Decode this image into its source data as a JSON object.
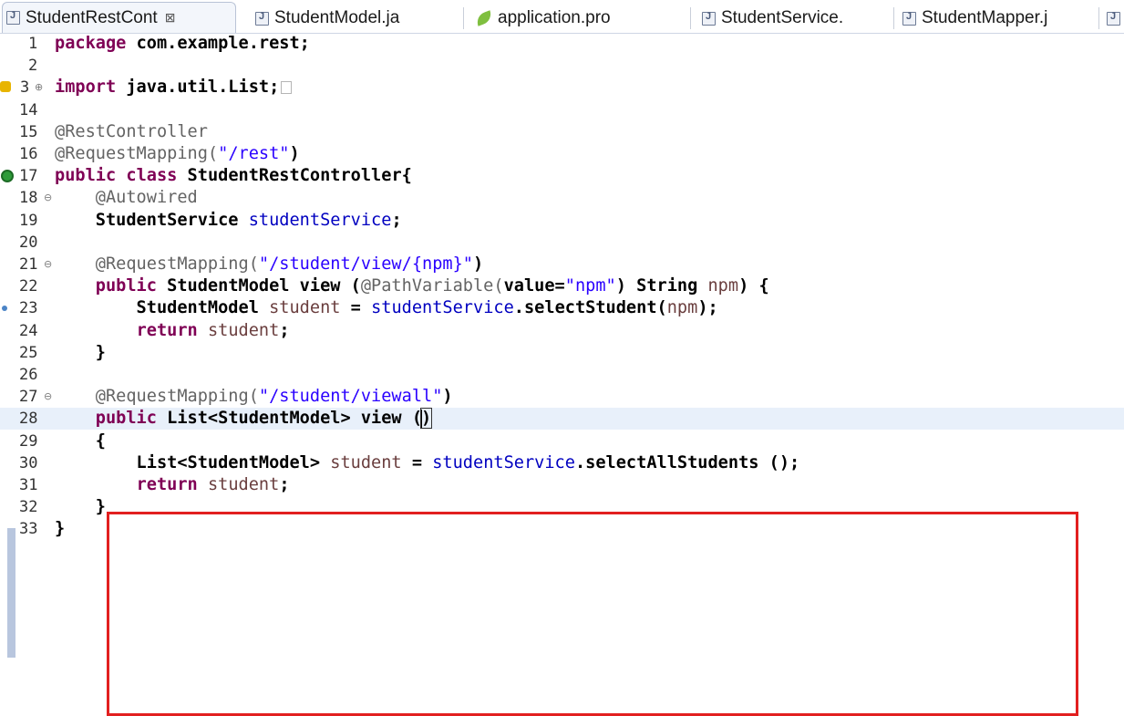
{
  "tabs": [
    {
      "label": "StudentRestCont",
      "icon": "java-file-icon",
      "active": true,
      "close": "⊠"
    },
    {
      "label": "StudentModel.ja",
      "icon": "java-file-icon",
      "active": false
    },
    {
      "label": "application.pro",
      "icon": "properties-leaf-icon",
      "active": false
    },
    {
      "label": "StudentService.",
      "icon": "java-file-icon",
      "active": false
    },
    {
      "label": "StudentMapper.j",
      "icon": "java-file-icon",
      "active": false
    }
  ],
  "editor": {
    "line_numbers": [
      "1",
      "2",
      "3",
      "14",
      "15",
      "16",
      "17",
      "18",
      "19",
      "20",
      "21",
      "22",
      "23",
      "24",
      "25",
      "26",
      "27",
      "28",
      "29",
      "30",
      "31",
      "32",
      "33"
    ],
    "lines": [
      [
        {
          "t": "package",
          "c": "kw"
        },
        {
          "t": " com.example.rest;",
          "c": "bold"
        }
      ],
      [],
      [
        {
          "t": "import",
          "c": "kw"
        },
        {
          "t": " java.util.List;",
          "c": "bold"
        }
      ],
      [],
      [
        {
          "t": "@RestController",
          "c": "ann"
        }
      ],
      [
        {
          "t": "@RequestMapping(",
          "c": "ann"
        },
        {
          "t": "\"/rest\"",
          "c": "str"
        },
        {
          "t": ")",
          "c": "bold"
        }
      ],
      [
        {
          "t": "public",
          "c": "kw"
        },
        {
          "t": " ",
          "c": ""
        },
        {
          "t": "class",
          "c": "kw"
        },
        {
          "t": " StudentRestController{",
          "c": "bold"
        }
      ],
      [
        {
          "t": "    ",
          "c": ""
        },
        {
          "t": "@Autowired",
          "c": "ann"
        }
      ],
      [
        {
          "t": "    StudentService ",
          "c": "bold"
        },
        {
          "t": "studentService",
          "c": "fld"
        },
        {
          "t": ";",
          "c": "bold"
        }
      ],
      [],
      [
        {
          "t": "    ",
          "c": ""
        },
        {
          "t": "@RequestMapping(",
          "c": "ann"
        },
        {
          "t": "\"/student/view/{npm}\"",
          "c": "str"
        },
        {
          "t": ")",
          "c": "bold"
        }
      ],
      [
        {
          "t": "    ",
          "c": ""
        },
        {
          "t": "public",
          "c": "kw"
        },
        {
          "t": " StudentModel view (",
          "c": "bold"
        },
        {
          "t": "@PathVariable(",
          "c": "ann"
        },
        {
          "t": "value=",
          "c": "bold"
        },
        {
          "t": "\"npm\"",
          "c": "str"
        },
        {
          "t": ") String ",
          "c": "bold"
        },
        {
          "t": "npm",
          "c": "var"
        },
        {
          "t": ") {",
          "c": "bold"
        }
      ],
      [
        {
          "t": "        StudentModel ",
          "c": "bold"
        },
        {
          "t": "student",
          "c": "var"
        },
        {
          "t": " = ",
          "c": "bold"
        },
        {
          "t": "studentService",
          "c": "fld"
        },
        {
          "t": ".selectStudent(",
          "c": "bold"
        },
        {
          "t": "npm",
          "c": "var"
        },
        {
          "t": ");",
          "c": "bold"
        }
      ],
      [
        {
          "t": "        ",
          "c": ""
        },
        {
          "t": "return",
          "c": "kw"
        },
        {
          "t": " ",
          "c": ""
        },
        {
          "t": "student",
          "c": "var"
        },
        {
          "t": ";",
          "c": "bold"
        }
      ],
      [
        {
          "t": "    }",
          "c": "bold"
        }
      ],
      [],
      [
        {
          "t": "    ",
          "c": ""
        },
        {
          "t": "@RequestMapping(",
          "c": "ann"
        },
        {
          "t": "\"/student/viewall\"",
          "c": "str"
        },
        {
          "t": ")",
          "c": "bold"
        }
      ],
      [
        {
          "t": "    ",
          "c": ""
        },
        {
          "t": "public",
          "c": "kw"
        },
        {
          "t": " List<StudentModel> view (",
          "c": "bold"
        },
        {
          "t": ")",
          "c": "bold"
        }
      ],
      [
        {
          "t": "    {",
          "c": "bold"
        }
      ],
      [
        {
          "t": "        List<StudentModel> ",
          "c": "bold"
        },
        {
          "t": "student",
          "c": "var"
        },
        {
          "t": " = ",
          "c": "bold"
        },
        {
          "t": "studentService",
          "c": "fld"
        },
        {
          "t": ".selectAllStudents ();",
          "c": "bold"
        }
      ],
      [
        {
          "t": "        ",
          "c": ""
        },
        {
          "t": "return",
          "c": "kw"
        },
        {
          "t": " ",
          "c": ""
        },
        {
          "t": "student",
          "c": "var"
        },
        {
          "t": ";",
          "c": "bold"
        }
      ],
      [
        {
          "t": "    }",
          "c": "bold"
        }
      ],
      [
        {
          "t": "}",
          "c": "bold"
        }
      ]
    ]
  },
  "colors": {
    "keyword": "#7f0055",
    "string": "#2a00ff",
    "annotation": "#646464",
    "field": "#0000c0",
    "local_variable": "#6a3e3e",
    "current_line": "#e8f0fa",
    "highlight_box": "#e22020"
  }
}
